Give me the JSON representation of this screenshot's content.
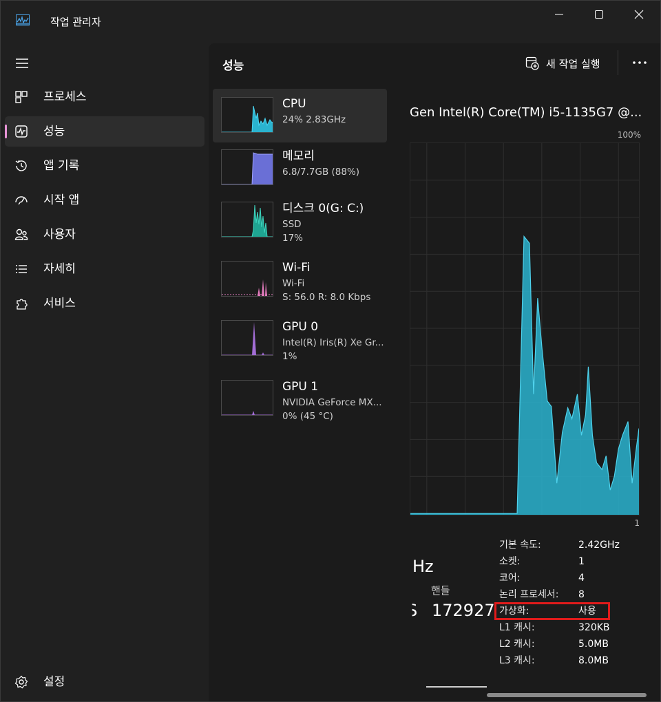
{
  "window": {
    "title": "작업 관리자"
  },
  "sidebar": {
    "items": [
      {
        "label": "프로세스",
        "icon": "grid-icon"
      },
      {
        "label": "성능",
        "icon": "pulse-icon",
        "active": true
      },
      {
        "label": "앱 기록",
        "icon": "history-icon"
      },
      {
        "label": "시작 앱",
        "icon": "gauge-icon"
      },
      {
        "label": "사용자",
        "icon": "users-icon"
      },
      {
        "label": "자세히",
        "icon": "list-icon"
      },
      {
        "label": "서비스",
        "icon": "puzzle-icon"
      }
    ],
    "settings_label": "설정"
  },
  "main": {
    "title": "성능",
    "run_task_label": "새 작업 실행"
  },
  "resources": [
    {
      "name": "CPU",
      "line1": "24% 2.83GHz",
      "line2": "",
      "color": "#2ab3cf"
    },
    {
      "name": "메모리",
      "line1": "6.8/7.7GB (88%)",
      "line2": "",
      "color": "#6a6fd6"
    },
    {
      "name": "디스크 0(G: C:)",
      "line1": "SSD",
      "line2": "17%",
      "color": "#1fa592"
    },
    {
      "name": "Wi-Fi",
      "line1": "Wi-Fi",
      "line2": "S: 56.0  R: 8.0 Kbps",
      "color": "#e57cbf"
    },
    {
      "name": "GPU 0",
      "line1": "Intel(R) Iris(R) Xe Gr...",
      "line2": "1%",
      "color": "#a36ed6"
    },
    {
      "name": "GPU 1",
      "line1": "NVIDIA GeForce MX...",
      "line2": "0%  (45 °C)",
      "color": "#a36ed6"
    }
  ],
  "detail": {
    "cpu_model": "Gen Intel(R) Core(TM) i5-1135G7 @...",
    "graph_max": "100%",
    "graph_min": "1",
    "speed_partial": "Hz",
    "handles_label": "핸들",
    "handles_value": "172927",
    "cut_glyph": "S",
    "specs": [
      {
        "label": "기본 속도:",
        "value": "2.42GHz"
      },
      {
        "label": "소켓:",
        "value": "1"
      },
      {
        "label": "코어:",
        "value": "4"
      },
      {
        "label": "논리 프로세서:",
        "value": "8"
      },
      {
        "label": "가상화:",
        "value": "사용"
      },
      {
        "label": "L1 캐시:",
        "value": "320KB"
      },
      {
        "label": "L2 캐시:",
        "value": "5.0MB"
      },
      {
        "label": "L3 캐시:",
        "value": "8.0MB"
      }
    ]
  },
  "colors": {
    "cpu": "#2ab3cf",
    "highlight": "#e01b1b",
    "accent": "#e794d6"
  }
}
